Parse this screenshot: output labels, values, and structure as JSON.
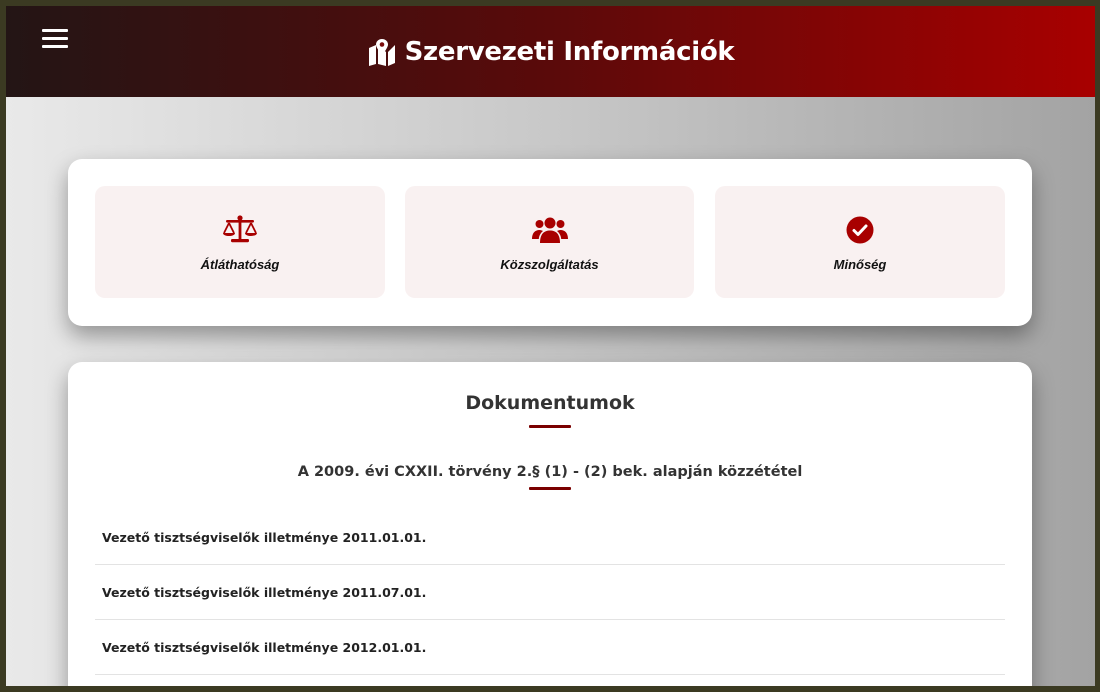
{
  "header": {
    "title": "Szervezeti Információk",
    "menu_icon": "hamburger-menu-icon",
    "title_icon": "map-icon",
    "gradient_colors": [
      "#231515",
      "#a80000"
    ]
  },
  "categories": [
    {
      "label": "Átláthatóság",
      "icon": "scale-balance-icon"
    },
    {
      "label": "Közszolgáltatás",
      "icon": "users-group-icon"
    },
    {
      "label": "Minőség",
      "icon": "check-circle-icon"
    }
  ],
  "documents": {
    "title": "Dokumentumok",
    "subtitle": "A 2009. évi CXXII. törvény 2.§ (1) - (2) bek. alapján közzététel",
    "items": [
      {
        "label": "Vezető tisztségviselők illetménye 2011.01.01."
      },
      {
        "label": "Vezető tisztségviselők illetménye 2011.07.01."
      },
      {
        "label": "Vezető tisztségviselők illetménye 2012.01.01."
      }
    ]
  },
  "colors": {
    "accent": "#a80000",
    "tile_background": "#f9f1f1",
    "underline": "#7a0000"
  }
}
